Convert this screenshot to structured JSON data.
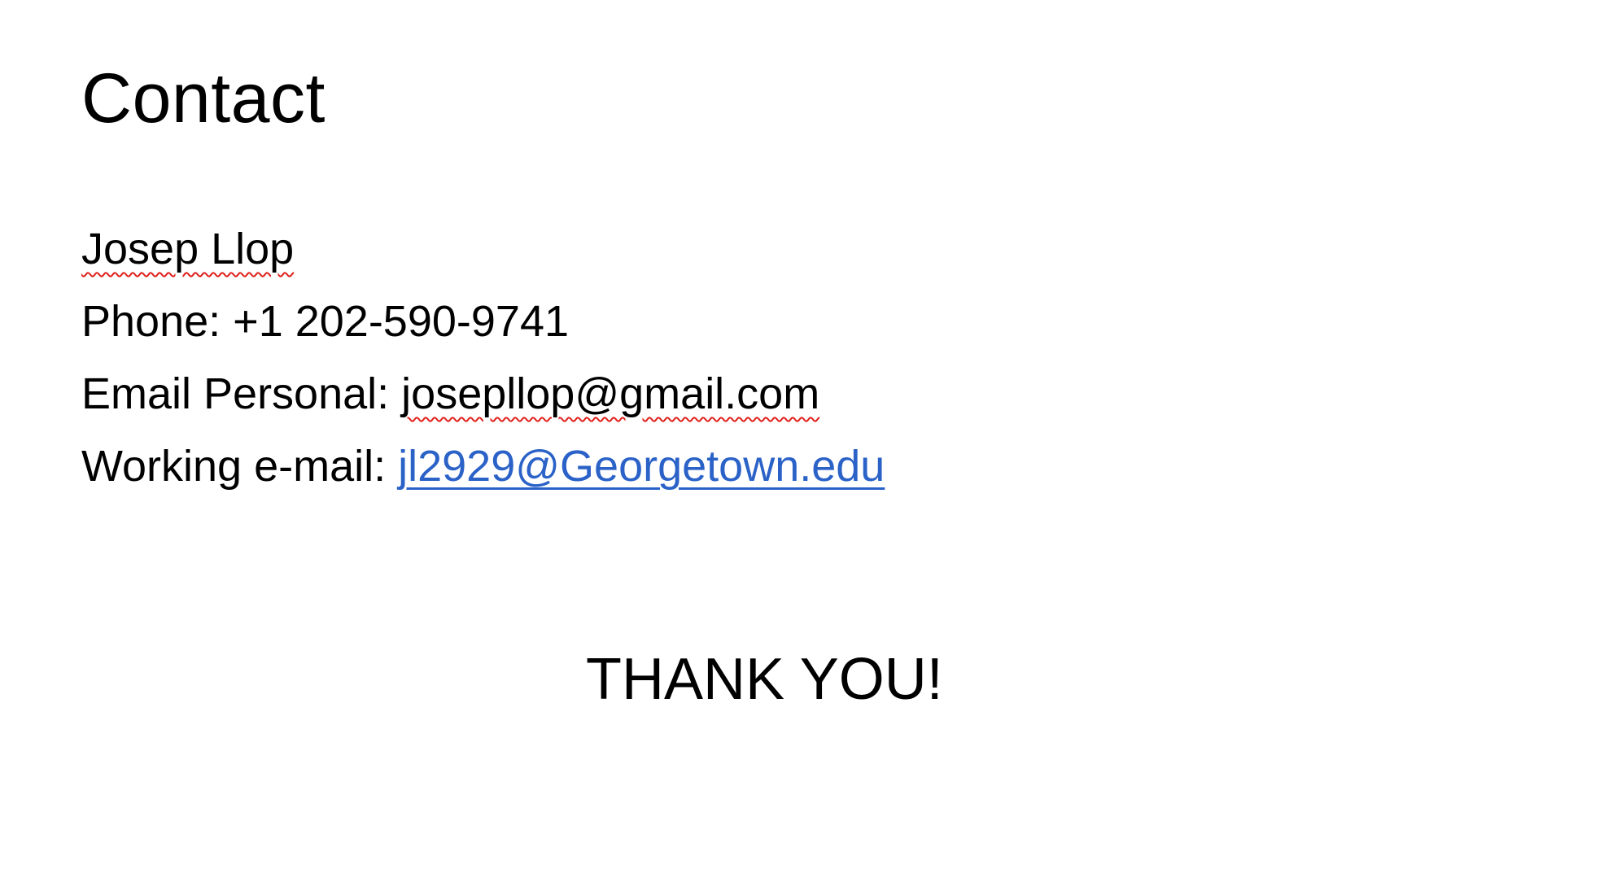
{
  "slide": {
    "title": "Contact",
    "contact": {
      "name": "Josep Llop",
      "phone_label": "Phone: ",
      "phone_value": "+1 202-590-9741",
      "personal_email_label": "Email Personal: ",
      "personal_email_value": "josepllop@gmail.com",
      "work_email_label": "Working e-mail: ",
      "work_email_value": "jl2929@Georgetown.edu"
    },
    "closing": "THANK YOU!"
  },
  "colors": {
    "link": "#2b62c8",
    "spellcheck_underline": "#e0201b",
    "text": "#000000",
    "background": "#ffffff"
  }
}
